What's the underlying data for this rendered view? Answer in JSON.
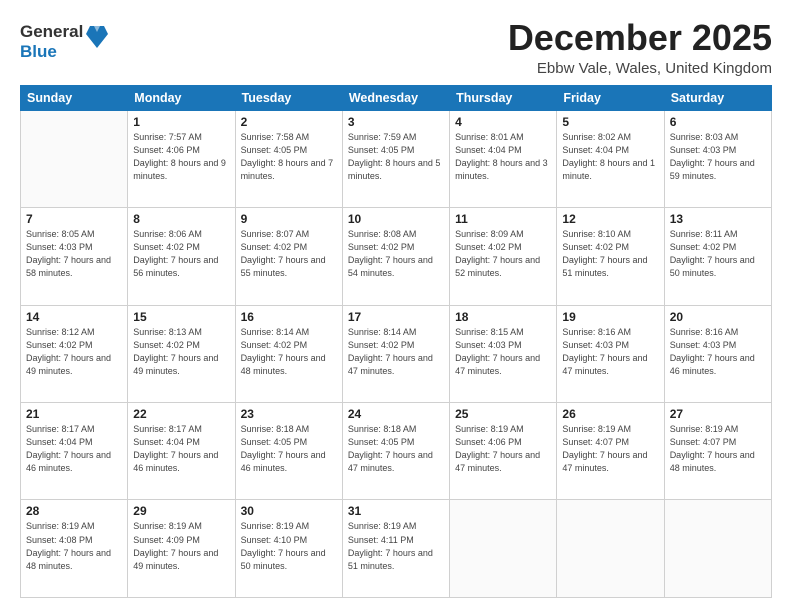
{
  "header": {
    "logo_general": "General",
    "logo_blue": "Blue",
    "title": "December 2025",
    "location": "Ebbw Vale, Wales, United Kingdom"
  },
  "weekdays": [
    "Sunday",
    "Monday",
    "Tuesday",
    "Wednesday",
    "Thursday",
    "Friday",
    "Saturday"
  ],
  "weeks": [
    [
      {
        "day": "",
        "sunrise": "",
        "sunset": "",
        "daylight": ""
      },
      {
        "day": "1",
        "sunrise": "Sunrise: 7:57 AM",
        "sunset": "Sunset: 4:06 PM",
        "daylight": "Daylight: 8 hours and 9 minutes."
      },
      {
        "day": "2",
        "sunrise": "Sunrise: 7:58 AM",
        "sunset": "Sunset: 4:05 PM",
        "daylight": "Daylight: 8 hours and 7 minutes."
      },
      {
        "day": "3",
        "sunrise": "Sunrise: 7:59 AM",
        "sunset": "Sunset: 4:05 PM",
        "daylight": "Daylight: 8 hours and 5 minutes."
      },
      {
        "day": "4",
        "sunrise": "Sunrise: 8:01 AM",
        "sunset": "Sunset: 4:04 PM",
        "daylight": "Daylight: 8 hours and 3 minutes."
      },
      {
        "day": "5",
        "sunrise": "Sunrise: 8:02 AM",
        "sunset": "Sunset: 4:04 PM",
        "daylight": "Daylight: 8 hours and 1 minute."
      },
      {
        "day": "6",
        "sunrise": "Sunrise: 8:03 AM",
        "sunset": "Sunset: 4:03 PM",
        "daylight": "Daylight: 7 hours and 59 minutes."
      }
    ],
    [
      {
        "day": "7",
        "sunrise": "Sunrise: 8:05 AM",
        "sunset": "Sunset: 4:03 PM",
        "daylight": "Daylight: 7 hours and 58 minutes."
      },
      {
        "day": "8",
        "sunrise": "Sunrise: 8:06 AM",
        "sunset": "Sunset: 4:02 PM",
        "daylight": "Daylight: 7 hours and 56 minutes."
      },
      {
        "day": "9",
        "sunrise": "Sunrise: 8:07 AM",
        "sunset": "Sunset: 4:02 PM",
        "daylight": "Daylight: 7 hours and 55 minutes."
      },
      {
        "day": "10",
        "sunrise": "Sunrise: 8:08 AM",
        "sunset": "Sunset: 4:02 PM",
        "daylight": "Daylight: 7 hours and 54 minutes."
      },
      {
        "day": "11",
        "sunrise": "Sunrise: 8:09 AM",
        "sunset": "Sunset: 4:02 PM",
        "daylight": "Daylight: 7 hours and 52 minutes."
      },
      {
        "day": "12",
        "sunrise": "Sunrise: 8:10 AM",
        "sunset": "Sunset: 4:02 PM",
        "daylight": "Daylight: 7 hours and 51 minutes."
      },
      {
        "day": "13",
        "sunrise": "Sunrise: 8:11 AM",
        "sunset": "Sunset: 4:02 PM",
        "daylight": "Daylight: 7 hours and 50 minutes."
      }
    ],
    [
      {
        "day": "14",
        "sunrise": "Sunrise: 8:12 AM",
        "sunset": "Sunset: 4:02 PM",
        "daylight": "Daylight: 7 hours and 49 minutes."
      },
      {
        "day": "15",
        "sunrise": "Sunrise: 8:13 AM",
        "sunset": "Sunset: 4:02 PM",
        "daylight": "Daylight: 7 hours and 49 minutes."
      },
      {
        "day": "16",
        "sunrise": "Sunrise: 8:14 AM",
        "sunset": "Sunset: 4:02 PM",
        "daylight": "Daylight: 7 hours and 48 minutes."
      },
      {
        "day": "17",
        "sunrise": "Sunrise: 8:14 AM",
        "sunset": "Sunset: 4:02 PM",
        "daylight": "Daylight: 7 hours and 47 minutes."
      },
      {
        "day": "18",
        "sunrise": "Sunrise: 8:15 AM",
        "sunset": "Sunset: 4:03 PM",
        "daylight": "Daylight: 7 hours and 47 minutes."
      },
      {
        "day": "19",
        "sunrise": "Sunrise: 8:16 AM",
        "sunset": "Sunset: 4:03 PM",
        "daylight": "Daylight: 7 hours and 47 minutes."
      },
      {
        "day": "20",
        "sunrise": "Sunrise: 8:16 AM",
        "sunset": "Sunset: 4:03 PM",
        "daylight": "Daylight: 7 hours and 46 minutes."
      }
    ],
    [
      {
        "day": "21",
        "sunrise": "Sunrise: 8:17 AM",
        "sunset": "Sunset: 4:04 PM",
        "daylight": "Daylight: 7 hours and 46 minutes."
      },
      {
        "day": "22",
        "sunrise": "Sunrise: 8:17 AM",
        "sunset": "Sunset: 4:04 PM",
        "daylight": "Daylight: 7 hours and 46 minutes."
      },
      {
        "day": "23",
        "sunrise": "Sunrise: 8:18 AM",
        "sunset": "Sunset: 4:05 PM",
        "daylight": "Daylight: 7 hours and 46 minutes."
      },
      {
        "day": "24",
        "sunrise": "Sunrise: 8:18 AM",
        "sunset": "Sunset: 4:05 PM",
        "daylight": "Daylight: 7 hours and 47 minutes."
      },
      {
        "day": "25",
        "sunrise": "Sunrise: 8:19 AM",
        "sunset": "Sunset: 4:06 PM",
        "daylight": "Daylight: 7 hours and 47 minutes."
      },
      {
        "day": "26",
        "sunrise": "Sunrise: 8:19 AM",
        "sunset": "Sunset: 4:07 PM",
        "daylight": "Daylight: 7 hours and 47 minutes."
      },
      {
        "day": "27",
        "sunrise": "Sunrise: 8:19 AM",
        "sunset": "Sunset: 4:07 PM",
        "daylight": "Daylight: 7 hours and 48 minutes."
      }
    ],
    [
      {
        "day": "28",
        "sunrise": "Sunrise: 8:19 AM",
        "sunset": "Sunset: 4:08 PM",
        "daylight": "Daylight: 7 hours and 48 minutes."
      },
      {
        "day": "29",
        "sunrise": "Sunrise: 8:19 AM",
        "sunset": "Sunset: 4:09 PM",
        "daylight": "Daylight: 7 hours and 49 minutes."
      },
      {
        "day": "30",
        "sunrise": "Sunrise: 8:19 AM",
        "sunset": "Sunset: 4:10 PM",
        "daylight": "Daylight: 7 hours and 50 minutes."
      },
      {
        "day": "31",
        "sunrise": "Sunrise: 8:19 AM",
        "sunset": "Sunset: 4:11 PM",
        "daylight": "Daylight: 7 hours and 51 minutes."
      },
      {
        "day": "",
        "sunrise": "",
        "sunset": "",
        "daylight": ""
      },
      {
        "day": "",
        "sunrise": "",
        "sunset": "",
        "daylight": ""
      },
      {
        "day": "",
        "sunrise": "",
        "sunset": "",
        "daylight": ""
      }
    ]
  ]
}
